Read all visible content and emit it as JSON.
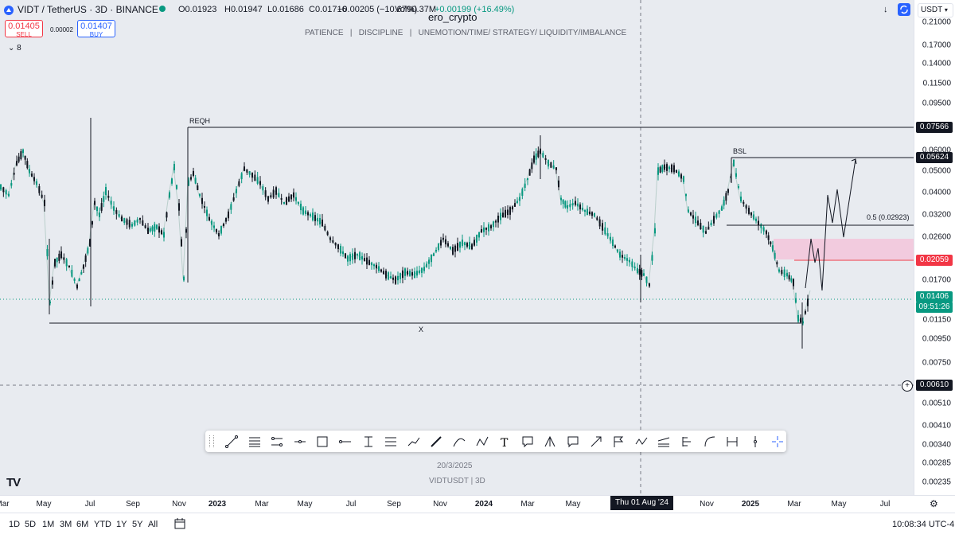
{
  "header": {
    "symbol": "VIDT / TetherUS · 3D · BINANCE",
    "ohlc": {
      "o": "O0.01923",
      "h": "H0.01947",
      "l": "L0.01686",
      "c": "C0.01716",
      "chg": "−0.00205 (−10.67%)"
    },
    "vol": "Vol90.37M",
    "extra": "+0.00199 (+16.49%)",
    "author": "ero_crypto",
    "tagline": "PATIENCE   |   DISCIPLINE   |   UNEMOTION/TIME/ STRATEGY/ LIQUIDITY/IMBALANCE",
    "indicators_count": "8",
    "currency": "USDT"
  },
  "trade": {
    "sell_price": "0.01405",
    "sell_label": "SELL",
    "spread": "0.00002",
    "buy_price": "0.01407",
    "buy_label": "BUY"
  },
  "price_axis": {
    "ticks": [
      "0.21000",
      "0.17000",
      "0.14000",
      "0.11500",
      "0.09500",
      "0.06000",
      "0.05000",
      "0.04000",
      "0.03200",
      "0.02600",
      "0.01700",
      "0.01150",
      "0.00950",
      "0.00750",
      "0.00510",
      "0.00410",
      "0.00340",
      "0.00285",
      "0.00235"
    ],
    "label_reqh": "0.07566",
    "label_bsl": "0.05624",
    "label_red": "0.02059",
    "label_current": "0.01406",
    "label_countdown": "09:51:26",
    "label_cross": "0.00610"
  },
  "annotations": {
    "reqh": "REQH",
    "bsl": "BSL",
    "fib": "0.5 (0.02923)",
    "x": "X"
  },
  "watermark": {
    "date": "20/3/2025",
    "symbol": "VIDTUSDT | 3D"
  },
  "time_axis": {
    "labels": [
      "Mar",
      "May",
      "Jul",
      "Sep",
      "Nov",
      "2023",
      "Mar",
      "May",
      "Jul",
      "Sep",
      "Nov",
      "2024",
      "Mar",
      "May",
      "Nov",
      "2025",
      "Mar",
      "May",
      "Jul"
    ],
    "crosshair_label": "Thu 01 Aug '24"
  },
  "bottom_bar": {
    "ranges": [
      "1D",
      "5D",
      "1M",
      "3M",
      "6M",
      "YTD",
      "1Y",
      "5Y",
      "All"
    ],
    "clock": "10:08:34 UTC-4"
  },
  "tools": [
    "trend-line",
    "horizontal-lines",
    "parallel-channel",
    "horizontal-ray",
    "rectangle",
    "line",
    "text-note",
    "fib-lines",
    "path",
    "brush",
    "curve",
    "polyline",
    "text",
    "callout",
    "pitchfork",
    "comment",
    "arrow",
    "flag",
    "zigzag",
    "signpost",
    "long-position",
    "curve-arrow",
    "range",
    "vertical-line",
    "cross-tool"
  ],
  "colors": {
    "up": "#089981",
    "down": "#131722",
    "red": "#f23645",
    "zone": "#f3c6da",
    "line": "#131722"
  }
}
